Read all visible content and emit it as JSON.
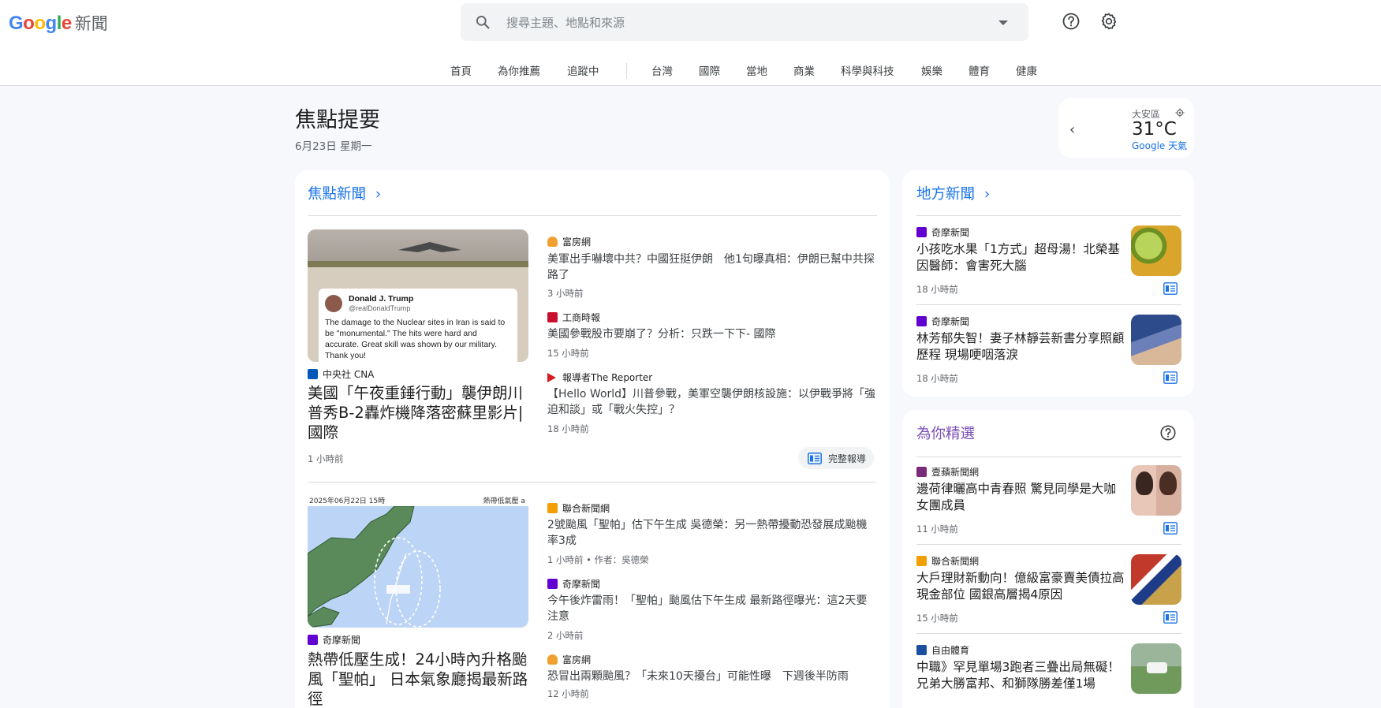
{
  "header": {
    "logo_google": "Google",
    "logo_news": "新聞",
    "search_placeholder": "搜尋主題、地點和來源"
  },
  "nav": {
    "items": [
      "首頁",
      "為你推薦",
      "追蹤中",
      "台灣",
      "國際",
      "當地",
      "商業",
      "科學與科技",
      "娛樂",
      "體育",
      "健康"
    ]
  },
  "page": {
    "title": "焦點提要",
    "date": "6月23日 星期一"
  },
  "weather": {
    "location": "大安區",
    "temperature": "31°C",
    "source": "Google 天氣"
  },
  "top_stories": {
    "title": "焦點新聞",
    "cluster1": {
      "main": {
        "tweet_name": "Donald J. Trump",
        "tweet_handle": "@realDonaldTrump",
        "tweet_text": "The damage to the Nuclear sites in Iran is said to be \"monumental.\" The hits were hard and accurate. Great skill was shown by our military. Thank you!",
        "source": "中央社 CNA",
        "headline": "美國「午夜重錘行動」襲伊朗川普秀B-2轟炸機降落密蘇里影片|國際",
        "time": "1 小時前"
      },
      "items": [
        {
          "source": "富房網",
          "headline": "美軍出手嚇壞中共？中國狂挺伊朗　他1句曝真相：伊朗已幫中共探路了",
          "time": "3 小時前"
        },
        {
          "source": "工商時報",
          "headline": "美國參戰股市要崩了？分析：只跌一下下- 國際",
          "time": "15 小時前"
        },
        {
          "source": "報導者The Reporter",
          "headline": "【Hello World】川普參戰，美軍空襲伊朗核設施：以伊戰爭將「強迫和談」或「戰火失控」？",
          "time": "18 小時前"
        }
      ],
      "full_coverage": "完整報導"
    },
    "cluster2": {
      "main": {
        "map_date": "2025年06月22日 15時",
        "map_label": "熱帶低氣壓 a",
        "source": "奇摩新聞",
        "headline": "熱帶低壓生成！24小時內升格颱風「聖帕」 日本氣象廳揭最新路徑",
        "time": ""
      },
      "items": [
        {
          "source": "聯合新聞網",
          "headline": "2號颱風「聖帕」估下午生成 吳德榮：另一熱帶擾動恐發展成颱機率3成",
          "time": "1 小時前 • 作者：吳德榮"
        },
        {
          "source": "奇摩新聞",
          "headline": "今午後炸雷雨！「聖帕」颱風估下午生成 最新路徑曝光：這2天要注意",
          "time": "2 小時前"
        },
        {
          "source": "富房網",
          "headline": "恐冒出兩顆颱風？「未來10天擾台」可能性曝　下週後半防雨",
          "time": "12 小時前"
        }
      ]
    }
  },
  "local_news": {
    "title": "地方新聞",
    "items": [
      {
        "source": "奇摩新聞",
        "headline": "小孩吃水果「1方式」超母湯！北榮基因醫師：會害死大腦",
        "time": "18 小時前"
      },
      {
        "source": "奇摩新聞",
        "headline": "林芳郁失智！妻子林靜芸新書分享照顧歷程 現場哽咽落淚",
        "time": "18 小時前"
      }
    ]
  },
  "picks": {
    "title": "為你精選",
    "items": [
      {
        "source": "壹蘋新聞網",
        "headline": "邊荷律曬高中青春照 驚見同學是大咖女團成員",
        "time": "11 小時前"
      },
      {
        "source": "聯合新聞網",
        "headline": "大戶理財新動向！億級富豪賣美債拉高現金部位 國銀高層揭4原因",
        "time": "15 小時前"
      },
      {
        "source": "自由體育",
        "headline": "中職》罕見單場3跑者三疊出局無礙！兄弟大勝富邦、和獅隊勝差僅1場",
        "time": ""
      }
    ]
  },
  "colors": {
    "accent": "#1a73e8",
    "picks_title": "#7b4fb8",
    "yahoo": "#6001d2",
    "udn": "#f29f05",
    "cna": "#0057b8",
    "reporter": "#d71920",
    "ctee": "#c8102e",
    "ltn": "#1c4fa1"
  },
  "icons": [
    "search-icon",
    "chevron-down-icon",
    "help-icon",
    "settings-icon",
    "chevron-left-icon",
    "location-icon",
    "chevron-right-icon",
    "full-coverage-icon"
  ]
}
